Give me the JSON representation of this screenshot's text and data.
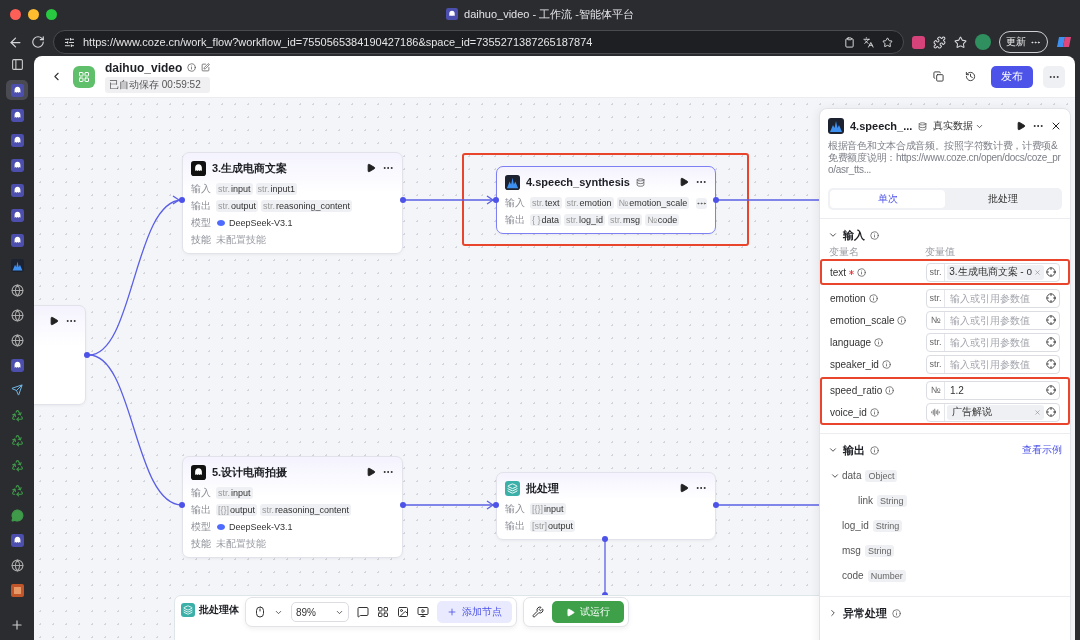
{
  "browser": {
    "title": "daihuo_video - 工作流 -智能体平台",
    "url": "https://www.coze.cn/work_flow?workflow_id=7550565384190427186&space_id=7355271387265187874",
    "update_label": "更新"
  },
  "tab_strip": [
    {
      "kind": "bot",
      "selected": true
    },
    {
      "kind": "bot",
      "selected": false
    },
    {
      "kind": "bot",
      "selected": false
    },
    {
      "kind": "bot",
      "selected": false
    },
    {
      "kind": "bot",
      "selected": false
    },
    {
      "kind": "bot",
      "selected": false
    },
    {
      "kind": "bot",
      "selected": false
    },
    {
      "kind": "speech",
      "selected": false
    },
    {
      "kind": "globe",
      "selected": false
    },
    {
      "kind": "globe",
      "selected": false
    },
    {
      "kind": "globe",
      "selected": false
    },
    {
      "kind": "bot",
      "selected": false
    },
    {
      "kind": "arrow",
      "selected": false
    },
    {
      "kind": "recycle",
      "selected": false
    },
    {
      "kind": "recycle",
      "selected": false
    },
    {
      "kind": "recycle",
      "selected": false
    },
    {
      "kind": "recycle",
      "selected": false
    },
    {
      "kind": "chat",
      "selected": false
    },
    {
      "kind": "bot",
      "selected": false
    },
    {
      "kind": "globe",
      "selected": false
    },
    {
      "kind": "shop",
      "selected": false
    }
  ],
  "workflow": {
    "name": "daihuo_video",
    "autosave": "已自动保存 00:59:52",
    "publish_label": "发布"
  },
  "nodes": [
    {
      "kind": "partial",
      "selected": false,
      "highlighted": false
    },
    {
      "kind": "llm",
      "title": "3.生成电商文案",
      "selected": false,
      "highlighted": false,
      "rows": [
        {
          "kind": "chips",
          "label": "输入",
          "chips": [
            {
              "type": "str.",
              "name": "input"
            },
            {
              "type": "str.",
              "name": "input1"
            }
          ]
        },
        {
          "kind": "chips",
          "label": "输出",
          "chips": [
            {
              "type": "str.",
              "name": "output"
            },
            {
              "type": "str.",
              "name": "reasoning_content"
            }
          ]
        },
        {
          "kind": "model",
          "label": "模型",
          "text": "DeepSeek-V3.1"
        },
        {
          "kind": "note",
          "label": "技能",
          "text": "未配置技能"
        }
      ]
    },
    {
      "kind": "plugin",
      "title": "4.speech_synthesis",
      "selected": true,
      "highlighted": true,
      "rows": [
        {
          "kind": "chips",
          "label": "输入",
          "overflow": true,
          "chips": [
            {
              "type": "str.",
              "name": "text"
            },
            {
              "type": "str.",
              "name": "emotion"
            },
            {
              "type": "№",
              "name": "emotion_scale"
            }
          ]
        },
        {
          "kind": "chips",
          "label": "输出",
          "chips": [
            {
              "type": "{ }",
              "name": "data"
            },
            {
              "type": "str.",
              "name": "log_id"
            },
            {
              "type": "str.",
              "name": "msg"
            },
            {
              "type": "№",
              "name": "code"
            }
          ]
        }
      ]
    },
    {
      "kind": "llm",
      "title": "5.设计电商拍摄",
      "selected": false,
      "highlighted": false,
      "rows": [
        {
          "kind": "chips",
          "label": "输入",
          "chips": [
            {
              "type": "str.",
              "name": "input"
            }
          ]
        },
        {
          "kind": "chips",
          "label": "输出",
          "chips": [
            {
              "type": "[{}]",
              "name": "output"
            },
            {
              "type": "str.",
              "name": "reasoning_content"
            }
          ]
        },
        {
          "kind": "model",
          "label": "模型",
          "text": "DeepSeek-V3.1"
        },
        {
          "kind": "note",
          "label": "技能",
          "text": "未配置技能"
        }
      ]
    },
    {
      "kind": "batch",
      "title": "批处理",
      "selected": false,
      "highlighted": false,
      "rows": [
        {
          "kind": "chips",
          "label": "输入",
          "chips": [
            {
              "type": "[{}]",
              "name": "input"
            }
          ]
        },
        {
          "kind": "chips",
          "label": "输出",
          "chips": [
            {
              "type": "[str]",
              "name": "output"
            }
          ]
        }
      ]
    }
  ],
  "batch_body": {
    "title": "批处理体"
  },
  "toolbar": {
    "zoom": "89%",
    "add_node_label": "添加节点",
    "run_label": "试运行"
  },
  "panel": {
    "title": "4.speech_...",
    "data_source": "真实数据",
    "description": "根据音色和文本合成音频。按照字符数计费，计费项&免费额度说明：https://www.coze.cn/open/docs/coze_pro/asr_tts...",
    "tabs": [
      {
        "label": "单次",
        "selected": true
      },
      {
        "label": "批处理",
        "selected": false
      }
    ],
    "input_section": {
      "title": "输入",
      "expanded": true,
      "name_header": "变量名",
      "value_header": "变量值",
      "params": [
        {
          "name": "text",
          "required": true,
          "type": "str.",
          "kind": "reference",
          "value": "3.生成电商文案 - o",
          "highlighted": true
        },
        {
          "name": "emotion",
          "required": false,
          "type": "str.",
          "kind": "empty",
          "placeholder": "输入或引用参数值",
          "highlighted": false
        },
        {
          "name": "emotion_scale",
          "required": false,
          "type": "№",
          "kind": "empty",
          "placeholder": "输入或引用参数值",
          "highlighted": false
        },
        {
          "name": "language",
          "required": false,
          "type": "str.",
          "kind": "empty",
          "placeholder": "输入或引用参数值",
          "highlighted": false
        },
        {
          "name": "speaker_id",
          "required": false,
          "type": "str.",
          "kind": "empty",
          "placeholder": "输入或引用参数值",
          "highlighted": false
        },
        {
          "name": "speed_ratio",
          "required": false,
          "type": "№",
          "kind": "value",
          "value": "1.2",
          "highlighted": true
        },
        {
          "name": "voice_id",
          "required": false,
          "kind": "choice",
          "value": "广告解说",
          "highlighted": true
        }
      ]
    },
    "output_section": {
      "title": "输出",
      "expanded": true,
      "link": "查看示例",
      "fields": [
        {
          "name": "data",
          "type": "Object",
          "expanded": true,
          "children": [
            {
              "name": "link",
              "type": "String"
            }
          ]
        },
        {
          "name": "log_id",
          "type": "String"
        },
        {
          "name": "msg",
          "type": "String"
        },
        {
          "name": "code",
          "type": "Number"
        }
      ]
    },
    "error_section": {
      "title": "异常处理",
      "expanded": false
    }
  }
}
